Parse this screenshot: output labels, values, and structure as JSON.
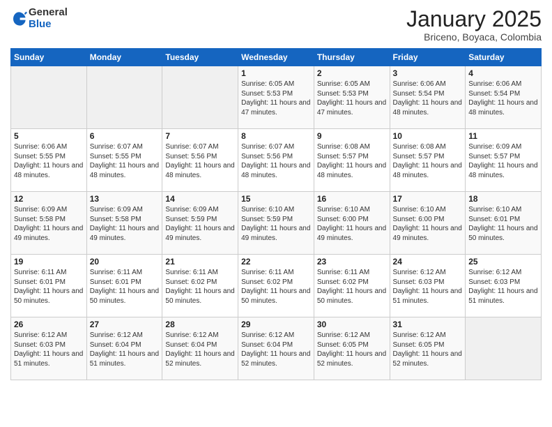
{
  "header": {
    "logo_general": "General",
    "logo_blue": "Blue",
    "month_title": "January 2025",
    "subtitle": "Briceno, Boyaca, Colombia"
  },
  "days_of_week": [
    "Sunday",
    "Monday",
    "Tuesday",
    "Wednesday",
    "Thursday",
    "Friday",
    "Saturday"
  ],
  "weeks": [
    [
      {
        "day": "",
        "content": ""
      },
      {
        "day": "",
        "content": ""
      },
      {
        "day": "",
        "content": ""
      },
      {
        "day": "1",
        "content": "Sunrise: 6:05 AM\nSunset: 5:53 PM\nDaylight: 11 hours and 47 minutes."
      },
      {
        "day": "2",
        "content": "Sunrise: 6:05 AM\nSunset: 5:53 PM\nDaylight: 11 hours and 47 minutes."
      },
      {
        "day": "3",
        "content": "Sunrise: 6:06 AM\nSunset: 5:54 PM\nDaylight: 11 hours and 48 minutes."
      },
      {
        "day": "4",
        "content": "Sunrise: 6:06 AM\nSunset: 5:54 PM\nDaylight: 11 hours and 48 minutes."
      }
    ],
    [
      {
        "day": "5",
        "content": "Sunrise: 6:06 AM\nSunset: 5:55 PM\nDaylight: 11 hours and 48 minutes."
      },
      {
        "day": "6",
        "content": "Sunrise: 6:07 AM\nSunset: 5:55 PM\nDaylight: 11 hours and 48 minutes."
      },
      {
        "day": "7",
        "content": "Sunrise: 6:07 AM\nSunset: 5:56 PM\nDaylight: 11 hours and 48 minutes."
      },
      {
        "day": "8",
        "content": "Sunrise: 6:07 AM\nSunset: 5:56 PM\nDaylight: 11 hours and 48 minutes."
      },
      {
        "day": "9",
        "content": "Sunrise: 6:08 AM\nSunset: 5:57 PM\nDaylight: 11 hours and 48 minutes."
      },
      {
        "day": "10",
        "content": "Sunrise: 6:08 AM\nSunset: 5:57 PM\nDaylight: 11 hours and 48 minutes."
      },
      {
        "day": "11",
        "content": "Sunrise: 6:09 AM\nSunset: 5:57 PM\nDaylight: 11 hours and 48 minutes."
      }
    ],
    [
      {
        "day": "12",
        "content": "Sunrise: 6:09 AM\nSunset: 5:58 PM\nDaylight: 11 hours and 49 minutes."
      },
      {
        "day": "13",
        "content": "Sunrise: 6:09 AM\nSunset: 5:58 PM\nDaylight: 11 hours and 49 minutes."
      },
      {
        "day": "14",
        "content": "Sunrise: 6:09 AM\nSunset: 5:59 PM\nDaylight: 11 hours and 49 minutes."
      },
      {
        "day": "15",
        "content": "Sunrise: 6:10 AM\nSunset: 5:59 PM\nDaylight: 11 hours and 49 minutes."
      },
      {
        "day": "16",
        "content": "Sunrise: 6:10 AM\nSunset: 6:00 PM\nDaylight: 11 hours and 49 minutes."
      },
      {
        "day": "17",
        "content": "Sunrise: 6:10 AM\nSunset: 6:00 PM\nDaylight: 11 hours and 49 minutes."
      },
      {
        "day": "18",
        "content": "Sunrise: 6:10 AM\nSunset: 6:01 PM\nDaylight: 11 hours and 50 minutes."
      }
    ],
    [
      {
        "day": "19",
        "content": "Sunrise: 6:11 AM\nSunset: 6:01 PM\nDaylight: 11 hours and 50 minutes."
      },
      {
        "day": "20",
        "content": "Sunrise: 6:11 AM\nSunset: 6:01 PM\nDaylight: 11 hours and 50 minutes."
      },
      {
        "day": "21",
        "content": "Sunrise: 6:11 AM\nSunset: 6:02 PM\nDaylight: 11 hours and 50 minutes."
      },
      {
        "day": "22",
        "content": "Sunrise: 6:11 AM\nSunset: 6:02 PM\nDaylight: 11 hours and 50 minutes."
      },
      {
        "day": "23",
        "content": "Sunrise: 6:11 AM\nSunset: 6:02 PM\nDaylight: 11 hours and 50 minutes."
      },
      {
        "day": "24",
        "content": "Sunrise: 6:12 AM\nSunset: 6:03 PM\nDaylight: 11 hours and 51 minutes."
      },
      {
        "day": "25",
        "content": "Sunrise: 6:12 AM\nSunset: 6:03 PM\nDaylight: 11 hours and 51 minutes."
      }
    ],
    [
      {
        "day": "26",
        "content": "Sunrise: 6:12 AM\nSunset: 6:03 PM\nDaylight: 11 hours and 51 minutes."
      },
      {
        "day": "27",
        "content": "Sunrise: 6:12 AM\nSunset: 6:04 PM\nDaylight: 11 hours and 51 minutes."
      },
      {
        "day": "28",
        "content": "Sunrise: 6:12 AM\nSunset: 6:04 PM\nDaylight: 11 hours and 52 minutes."
      },
      {
        "day": "29",
        "content": "Sunrise: 6:12 AM\nSunset: 6:04 PM\nDaylight: 11 hours and 52 minutes."
      },
      {
        "day": "30",
        "content": "Sunrise: 6:12 AM\nSunset: 6:05 PM\nDaylight: 11 hours and 52 minutes."
      },
      {
        "day": "31",
        "content": "Sunrise: 6:12 AM\nSunset: 6:05 PM\nDaylight: 11 hours and 52 minutes."
      },
      {
        "day": "",
        "content": ""
      }
    ]
  ]
}
